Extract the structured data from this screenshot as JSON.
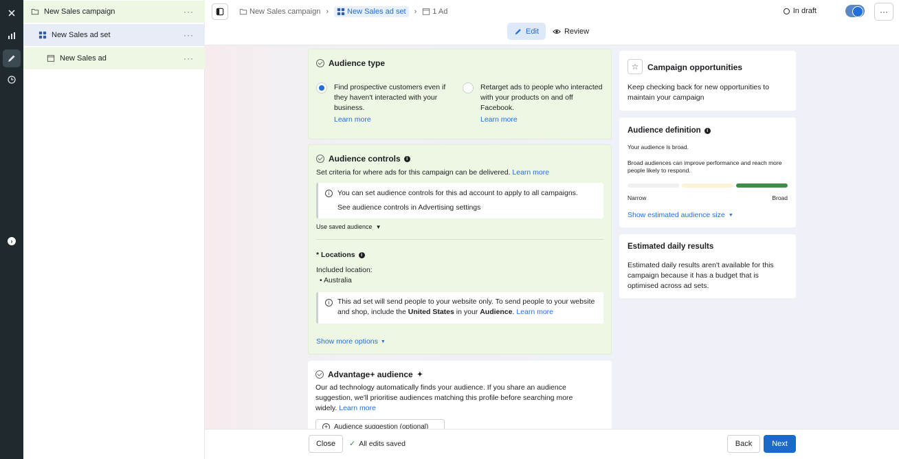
{
  "tree": {
    "campaign": "New Sales campaign",
    "adset": "New Sales ad set",
    "ad": "New Sales ad",
    "more": "···"
  },
  "topbar": {
    "crumbs": [
      "New Sales campaign",
      "New Sales ad set",
      "1 Ad"
    ],
    "status": "In draft",
    "more": "···",
    "modes": {
      "edit": "Edit",
      "review": "Review"
    }
  },
  "audience_type": {
    "title": "Audience type",
    "option1": "Find prospective customers even if they haven't interacted with your business.",
    "option2": "Retarget ads to people who interacted with your products on and off Facebook.",
    "learn_more": "Learn more"
  },
  "audience_controls": {
    "title": "Audience controls",
    "desc": "Set criteria for where ads for this campaign can be delivered.",
    "learn_more": "Learn more",
    "notice": "You can set audience controls for this ad account to apply to all campaigns.",
    "notice_link": "See audience controls in Advertising settings",
    "saved": "Use saved audience",
    "locations_title": "* Locations",
    "included": "Included location:",
    "location": "Australia",
    "notice2_a": "This ad set will send people to your website only. To send people to your website and shop, include the ",
    "notice2_b": "United States",
    "notice2_c": " in your ",
    "notice2_d": "Audience",
    "notice2_e": ".",
    "show_more": "Show more options"
  },
  "advantage": {
    "title": "Advantage+ audience",
    "desc": "Our ad technology automatically finds your audience. If you share an audience suggestion, we'll prioritise audiences matching this profile before searching more widely.",
    "learn_more": "Learn more",
    "suggestion": "Audience suggestion (optional)"
  },
  "opportunities": {
    "title": "Campaign opportunities",
    "desc": "Keep checking back for new opportunities to maintain your campaign"
  },
  "definition": {
    "title": "Audience definition",
    "line1": "Your audience is broad.",
    "line2": "Broad audiences can improve performance and reach more people likely to respond.",
    "narrow": "Narrow",
    "broad": "Broad",
    "show_size": "Show estimated audience size",
    "level": "broad"
  },
  "daily": {
    "title": "Estimated daily results",
    "desc": "Estimated daily results aren't available for this campaign because it has a budget that is optimised across ad sets."
  },
  "footer": {
    "close": "Close",
    "saved": "All edits saved",
    "back": "Back",
    "next": "Next"
  },
  "colors": {
    "accent": "#216fdb",
    "primary_button": "#1b6ac9",
    "rail": "#1f2a2e",
    "meter_broad": "#3e8e4a"
  }
}
